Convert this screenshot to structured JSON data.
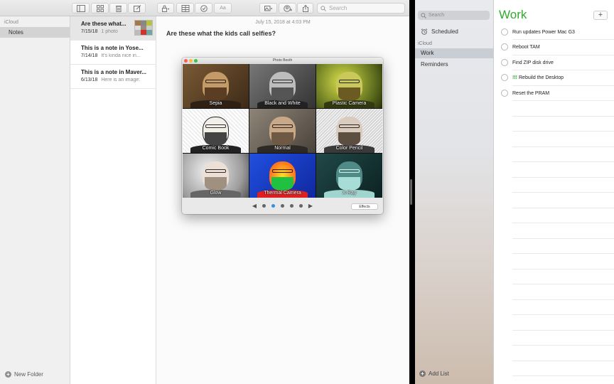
{
  "notes_app": {
    "toolbar": {
      "search_placeholder": "Search",
      "format_button": "Aa"
    },
    "sidebar": {
      "account": "iCloud",
      "folders": [
        "Notes"
      ],
      "new_folder": "New Folder"
    },
    "note_list": [
      {
        "title": "Are these what...",
        "date": "7/15/18",
        "snippet": "1 photo"
      },
      {
        "title": "This is a note in Yose...",
        "date": "7/14/18",
        "snippet": "It's kinda nice in..."
      },
      {
        "title": "This is a note in Maver...",
        "date": "6/13/18",
        "snippet": "Here is an image:"
      }
    ],
    "editor": {
      "date": "July 15, 2018 at 4:03 PM",
      "heading": "Are these what the kids call selfies?"
    }
  },
  "photo_booth": {
    "title": "Photo Booth",
    "effects": [
      "Sepia",
      "Black and White",
      "Plastic Camera",
      "Comic Book",
      "Normal",
      "Color Pencil",
      "Glow",
      "Thermal Camera",
      "X-Ray"
    ],
    "effects_button": "Effects",
    "pages": 5,
    "active_page": 2
  },
  "reminders_app": {
    "search_placeholder": "Search",
    "scheduled": "Scheduled",
    "account": "iCloud",
    "lists": [
      "Work",
      "Reminders"
    ],
    "add_list": "Add List",
    "list_title": "Work",
    "accent_color": "#2eab2e",
    "items": [
      {
        "text": "Run updates Power Mac G3",
        "priority": ""
      },
      {
        "text": "Reboot TAM",
        "priority": ""
      },
      {
        "text": "Find ZIP disk drive",
        "priority": ""
      },
      {
        "text": "Rebuild the Desktop",
        "priority": "!!!"
      },
      {
        "text": "Reset the PRAM",
        "priority": ""
      }
    ]
  }
}
